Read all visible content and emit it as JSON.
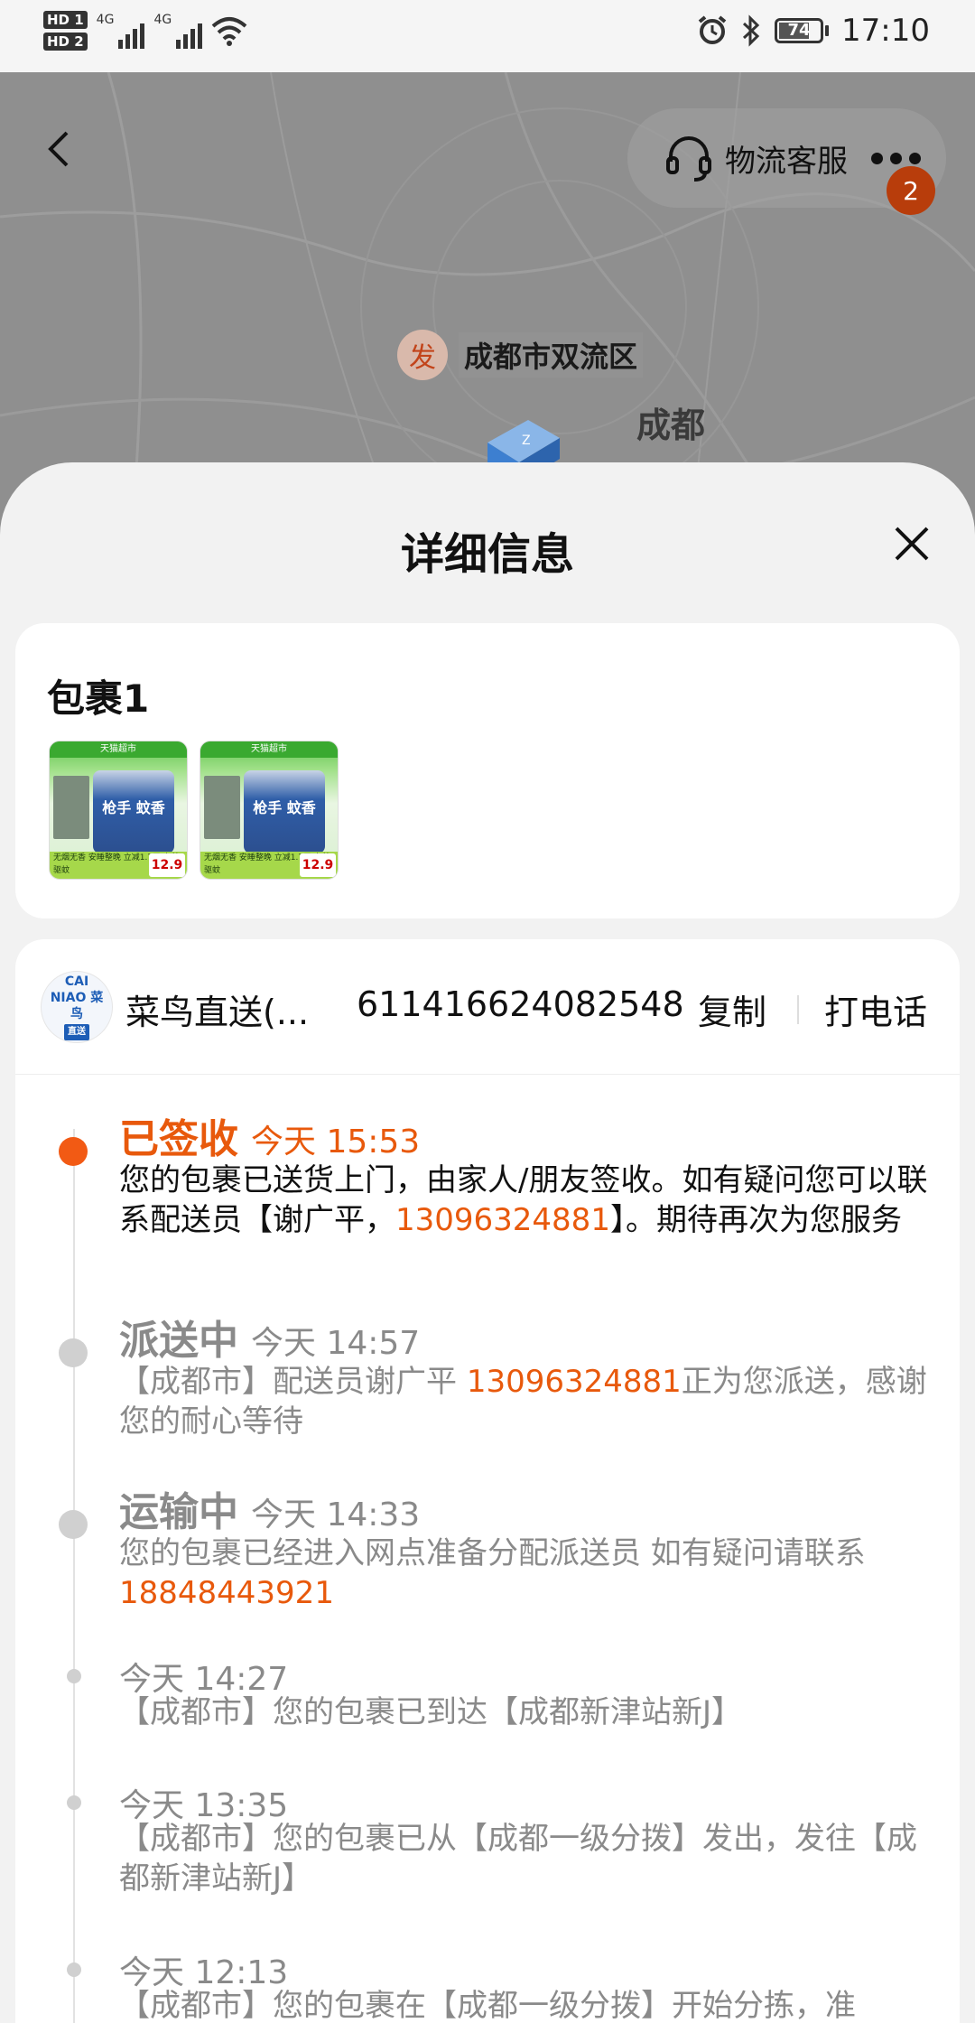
{
  "status_bar": {
    "sim1": "HD 1",
    "sim2": "HD 2",
    "net1": "4G",
    "net2": "4G",
    "battery": "74",
    "time": "17:10"
  },
  "map": {
    "customer_service_label": "物流客服",
    "badge_count": "2",
    "origin_marker": "发",
    "origin_name": "成都市双流区",
    "city_label": "成都"
  },
  "sheet": {
    "title": "详细信息"
  },
  "package": {
    "title": "包裹1",
    "thumbnails": [
      {
        "header": "天猫超市",
        "label": "枪手 蚊香",
        "strip": "无烟无香 安睡整晚 立减1.7元 有效驱蚊",
        "price": "12.9"
      },
      {
        "header": "天猫超市",
        "label": "枪手 蚊香",
        "strip": "无烟无香 安睡整晚 立减1.7元 有效驱蚊",
        "price": "12.9"
      }
    ]
  },
  "carrier": {
    "logo_text": "CAI NIAO 菜鸟",
    "logo_sub": "直送",
    "name": "菜鸟直送(...",
    "tracking_number": "611416624082548",
    "copy_label": "复制",
    "call_label": "打电话"
  },
  "events": [
    {
      "status": "已签收",
      "time": "今天 15:53",
      "desc_before": "您的包裹已送货上门，由家人/朋友签收。如有疑问您可以联系配送员【谢广平，",
      "phone": "13096324881",
      "desc_after": "】。期待再次为您服务"
    },
    {
      "status": "派送中",
      "time": "今天 14:57",
      "desc_before": "【成都市】配送员谢广平 ",
      "phone": "13096324881",
      "desc_after": "正为您派送，感谢您的耐心等待"
    },
    {
      "status": "运输中",
      "time": "今天 14:33",
      "desc_before": "您的包裹已经进入网点准备分配派送员 如有疑问请联系",
      "phone": "18848443921",
      "desc_after": ""
    },
    {
      "status": "",
      "time": "今天 14:27",
      "desc_before": "【成都市】您的包裹已到达【成都新津站新J】",
      "phone": "",
      "desc_after": ""
    },
    {
      "status": "",
      "time": "今天 13:35",
      "desc_before": "【成都市】您的包裹已从【成都一级分拨】发出，发往【成都新津站新J】",
      "phone": "",
      "desc_after": ""
    },
    {
      "status": "",
      "time": "今天 12:13",
      "desc_before": "【成都市】您的包裹在【成都一级分拨】开始分拣，准",
      "phone": "",
      "desc_after": ""
    }
  ],
  "colors": {
    "accent": "#f25a14",
    "accent_text": "#e8590c",
    "muted_text": "#8a8a8a",
    "badge": "#b83d0b"
  },
  "icons": [
    "back-arrow-icon",
    "headset-icon",
    "more-icon",
    "close-icon",
    "truck-icon",
    "wifi-icon",
    "alarm-icon",
    "bluetooth-icon"
  ]
}
